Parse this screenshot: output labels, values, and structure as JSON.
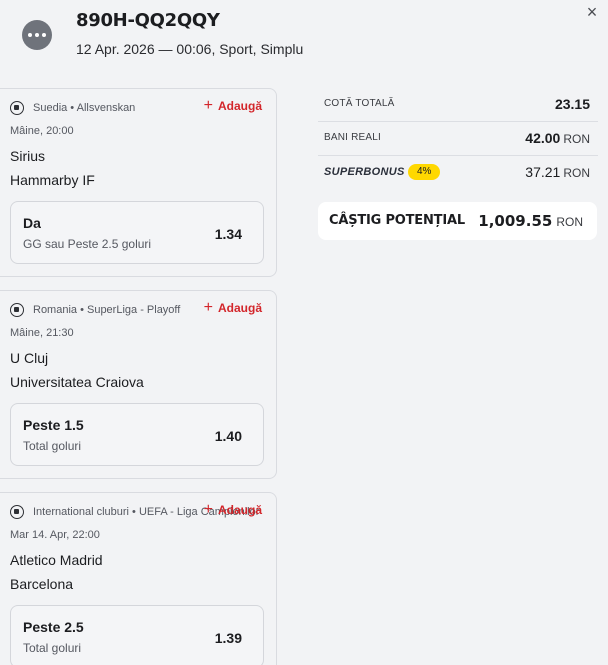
{
  "header": {
    "ticket_id": "890H-QQ2QQY",
    "meta": "12 Apr. 2026 — 00:06, Sport, Simplu",
    "close_symbol": "×"
  },
  "add_label": "Adaugă",
  "events": [
    {
      "league": "Suedia • Allsvenskan",
      "when": "Mâine, 20:00",
      "team1": "Sirius",
      "team2": "Hammarby IF",
      "selection": "Da",
      "market": "GG sau Peste 2.5 goluri",
      "odd": "1.34"
    },
    {
      "league": "Romania • SuperLiga - Playoff",
      "when": "Mâine, 21:30",
      "team1": "U Cluj",
      "team2": "Universitatea Craiova",
      "selection": "Peste 1.5",
      "market": "Total goluri",
      "odd": "1.40"
    },
    {
      "league": "International cluburi • UEFA - Liga Campionilor",
      "when": "Mar 14. Apr, 22:00",
      "team1": "Atletico Madrid",
      "team2": "Barcelona",
      "selection": "Peste 2.5",
      "market": "Total goluri",
      "odd": "1.39"
    }
  ],
  "summary": {
    "total_odds_label": "COTĂ TOTALĂ",
    "total_odds_value": "23.15",
    "real_money_label": "BANI REALI",
    "real_money_value": "42.00",
    "currency": "RON",
    "superbonus_label": "SUPERBONUS",
    "superbonus_percent": "4%",
    "superbonus_value": "37.21",
    "potential_label": "CÂȘTIG POTENȚIAL",
    "potential_value": "1,009.55"
  },
  "colors": {
    "accent_red": "#d3262b",
    "badge_yellow": "#ffd800",
    "background": "#f2f3f5"
  }
}
